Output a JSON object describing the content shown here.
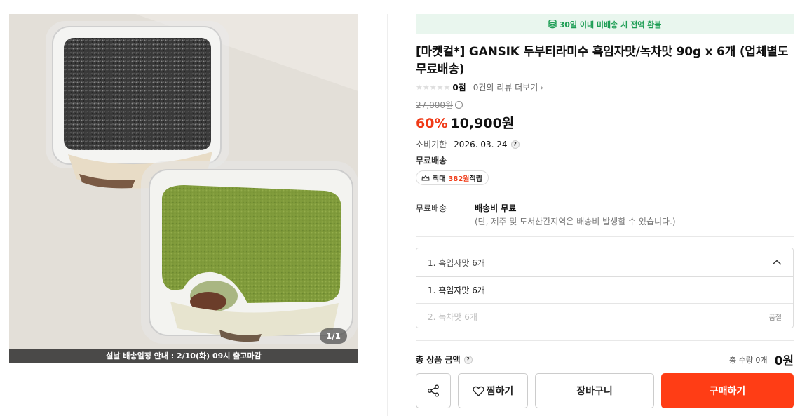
{
  "image": {
    "counter": "1/1",
    "notice": "설날 배송일정 안내 : 2/10(화) 09시 출고마감"
  },
  "banner": {
    "text": "30일 이내 미배송 시 전액 환불",
    "icon": "coin-stack-icon",
    "color": "#1e9e55"
  },
  "product": {
    "title": "[마켓컬*] GANSIK 두부티라미수 흑임자맛/녹차맛 90g x 6개 (업체별도 무료배송)",
    "rating_score": "0점",
    "review_link": "0건의 리뷰 더보기",
    "original_price": "27,000원",
    "discount": "60%",
    "price": "10,900원",
    "expiry_label": "소비기한",
    "expiry_date": "2026. 03. 24",
    "shipping_tag": "무료배송",
    "points": {
      "prefix": "최대",
      "amount": "382원",
      "suffix": "적립"
    }
  },
  "shipping": {
    "label": "무료배송",
    "main": "배송비 무료",
    "sub": "(단, 제주 및 도서산간지역은 배송비 발생할 수 있습니다.)"
  },
  "options": {
    "selected": "1. 흑임자맛 6개",
    "items": [
      {
        "label": "1. 흑임자맛 6개",
        "status": ""
      },
      {
        "label": "2. 녹차맛 6개",
        "status": "품절"
      }
    ]
  },
  "total": {
    "label": "총 상품 금액",
    "qty": "총 수량 0개",
    "amount": "0원"
  },
  "buttons": {
    "wish": "찜하기",
    "cart": "장바구니",
    "buy": "구매하기"
  },
  "colors": {
    "accent": "#ff3d15",
    "discount": "#f03a17"
  }
}
